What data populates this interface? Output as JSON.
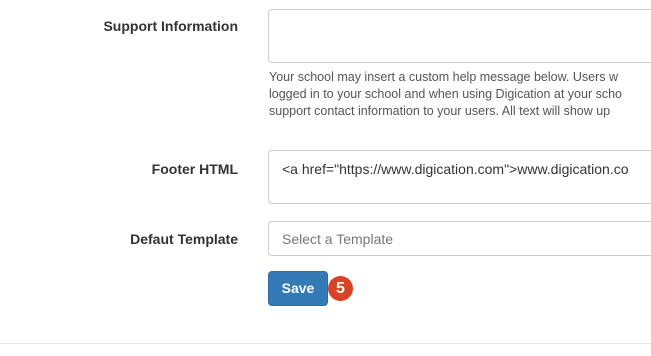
{
  "support_information": {
    "label": "Support Information",
    "value": "",
    "help_lines": [
      "Your school may insert a custom help message below. Users w",
      "logged in to your school and when using Digication at your scho",
      "support contact information to your users. All text will show up"
    ]
  },
  "footer_html": {
    "label": "Footer HTML",
    "value": "<a href=\"https://www.digication.com\">www.digication.co"
  },
  "default_template": {
    "label": "Defaut Template",
    "placeholder": "Select a Template"
  },
  "save_button": {
    "label": "Save"
  },
  "step_badge": {
    "number": "5",
    "color": "#d94225"
  },
  "colors": {
    "primary_button": "#337ab7",
    "field_border": "#cccccc",
    "label_text": "#333333",
    "help_text": "#555555"
  }
}
